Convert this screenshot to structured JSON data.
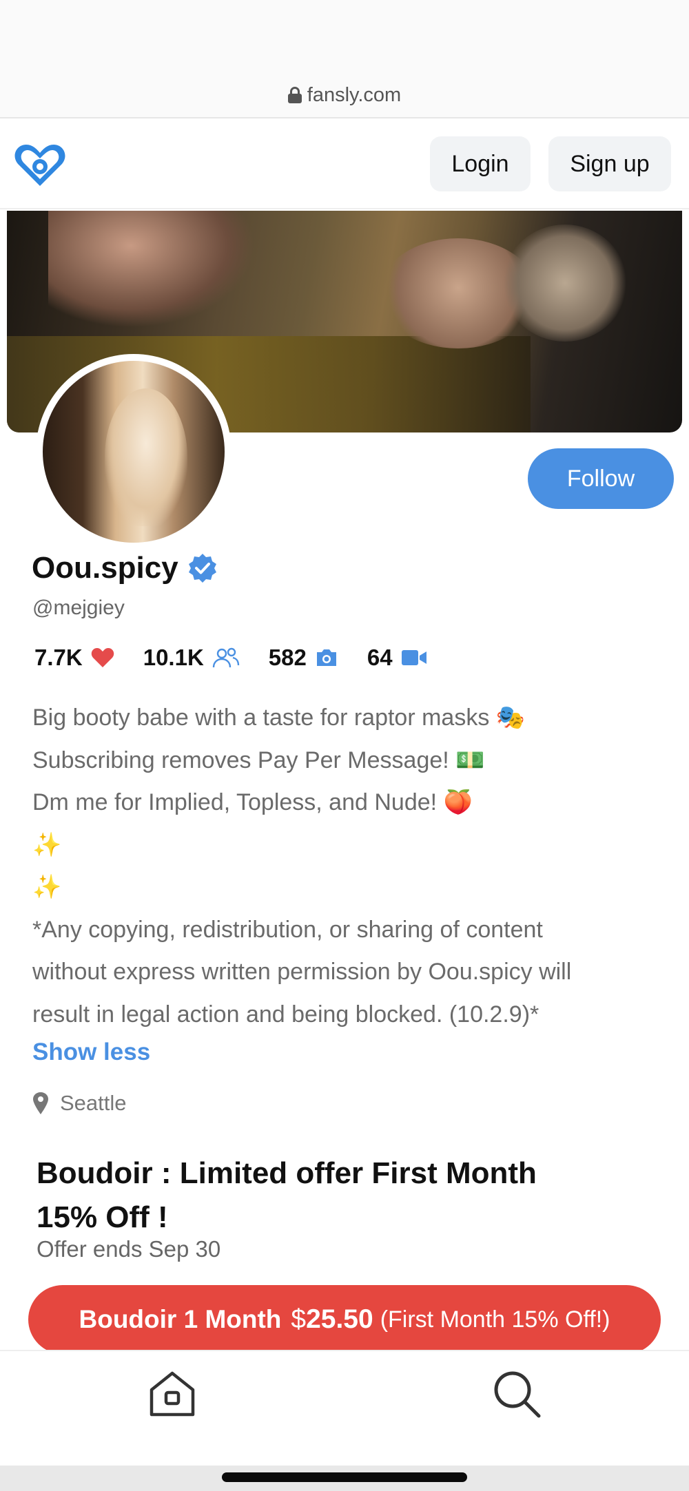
{
  "browser": {
    "url": "fansly.com"
  },
  "header": {
    "login_label": "Login",
    "signup_label": "Sign up"
  },
  "profile": {
    "follow_label": "Follow",
    "name": "Oou.spicy",
    "handle": "@mejgiey",
    "stats": {
      "likes": "7.7K",
      "followers": "10.1K",
      "photos": "582",
      "videos": "64"
    },
    "bio": [
      "Big booty babe with a taste for raptor masks 🎭",
      "Subscribing removes Pay Per Message! 💵",
      "Dm me for Implied, Topless, and Nude! 🍑",
      "✨",
      "✨",
      "*Any copying, redistribution, or sharing of content",
      "without express written permission by Oou.spicy will",
      "result in legal action and being blocked. (10.2.9)*"
    ],
    "show_less_label": "Show less",
    "location": "Seattle"
  },
  "promo": {
    "title_line1": "Boudoir : Limited offer First Month",
    "title_line2": "15% Off !",
    "subtitle": "Offer ends Sep 30",
    "button": {
      "tier": "Boudoir 1 Month",
      "currency": "$",
      "price": "25.50",
      "note": "(First Month 15% Off!)"
    }
  },
  "colors": {
    "accent": "#4a90e2",
    "subscribe": "#e5473f",
    "like": "#e54b4b"
  },
  "icons": [
    "lock-icon",
    "fansly-logo",
    "verified-icon",
    "heart-icon",
    "followers-icon",
    "camera-icon",
    "video-icon",
    "location-pin-icon",
    "home-icon",
    "search-icon"
  ]
}
